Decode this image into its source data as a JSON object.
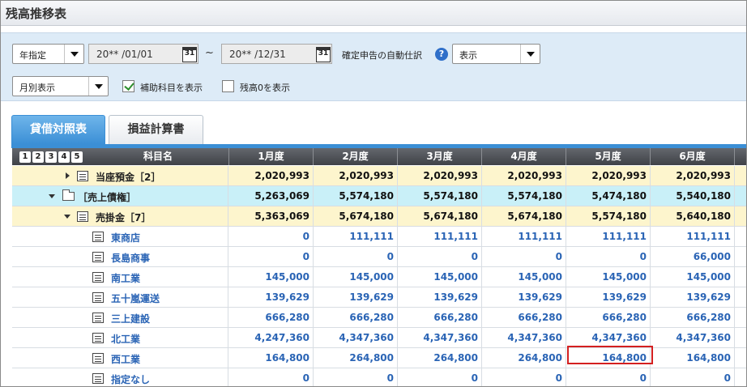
{
  "window": {
    "title": "残高推移表"
  },
  "filters": {
    "period_type": "年指定",
    "date_from": "20** /01/01",
    "date_to": "20** /12/31",
    "tilde": "~",
    "calendar_label": "31",
    "auto_entry_label": "確定申告の自動仕訳",
    "help_glyph": "?",
    "auto_entry_value": "表示",
    "display_mode": "月別表示",
    "show_sub_accounts_label": "補助科目を表示",
    "show_sub_accounts": true,
    "show_zero_label": "残高0を表示",
    "show_zero": false
  },
  "tabs": [
    {
      "label": "貸借対照表",
      "active": true
    },
    {
      "label": "損益計算書",
      "active": false
    }
  ],
  "table": {
    "levels": [
      "1",
      "2",
      "3",
      "4",
      "5"
    ],
    "header_name": "科目名",
    "months": [
      "1月度",
      "2月度",
      "3月度",
      "4月度",
      "5月度",
      "6月度"
    ],
    "rows": [
      {
        "name": "当座預金［2］",
        "style": "yellow",
        "icon": "ledger-icon",
        "values": [
          "2,020,993",
          "2,020,993",
          "2,020,993",
          "2,020,993",
          "2,020,993",
          "2,020,993"
        ]
      },
      {
        "name": "［売上債権］",
        "style": "cyan",
        "icon": "folder-icon",
        "values": [
          "5,263,069",
          "5,574,180",
          "5,574,180",
          "5,574,180",
          "5,474,180",
          "5,540,180"
        ]
      },
      {
        "name": "売掛金［7］",
        "style": "yellow",
        "icon": "ledger-icon",
        "values": [
          "5,363,069",
          "5,674,180",
          "5,674,180",
          "5,674,180",
          "5,574,180",
          "5,640,180"
        ]
      },
      {
        "name": "東商店",
        "style": "white",
        "icon": "sub-ledger-icon",
        "values": [
          "0",
          "111,111",
          "111,111",
          "111,111",
          "111,111",
          "111,111"
        ]
      },
      {
        "name": "長島商事",
        "style": "white",
        "icon": "sub-ledger-icon",
        "values": [
          "0",
          "0",
          "0",
          "0",
          "0",
          "66,000"
        ]
      },
      {
        "name": "南工業",
        "style": "white",
        "icon": "sub-ledger-icon",
        "values": [
          "145,000",
          "145,000",
          "145,000",
          "145,000",
          "145,000",
          "145,000"
        ]
      },
      {
        "name": "五十嵐運送",
        "style": "white",
        "icon": "sub-ledger-icon",
        "values": [
          "139,629",
          "139,629",
          "139,629",
          "139,629",
          "139,629",
          "139,629"
        ]
      },
      {
        "name": "三上建設",
        "style": "white",
        "icon": "sub-ledger-icon",
        "values": [
          "666,280",
          "666,280",
          "666,280",
          "666,280",
          "666,280",
          "666,280"
        ]
      },
      {
        "name": "北工業",
        "style": "white",
        "icon": "sub-ledger-icon",
        "values": [
          "4,247,360",
          "4,347,360",
          "4,347,360",
          "4,347,360",
          "4,347,360",
          "4,347,360"
        ]
      },
      {
        "name": "西工業",
        "style": "white",
        "icon": "sub-ledger-icon",
        "values": [
          "164,800",
          "264,800",
          "264,800",
          "264,800",
          "164,800",
          "164,800"
        ]
      },
      {
        "name": "指定なし",
        "style": "white",
        "icon": "sub-ledger-icon",
        "values": [
          "0",
          "0",
          "0",
          "0",
          "0",
          "0"
        ]
      }
    ]
  },
  "highlight_color": "#d42020"
}
